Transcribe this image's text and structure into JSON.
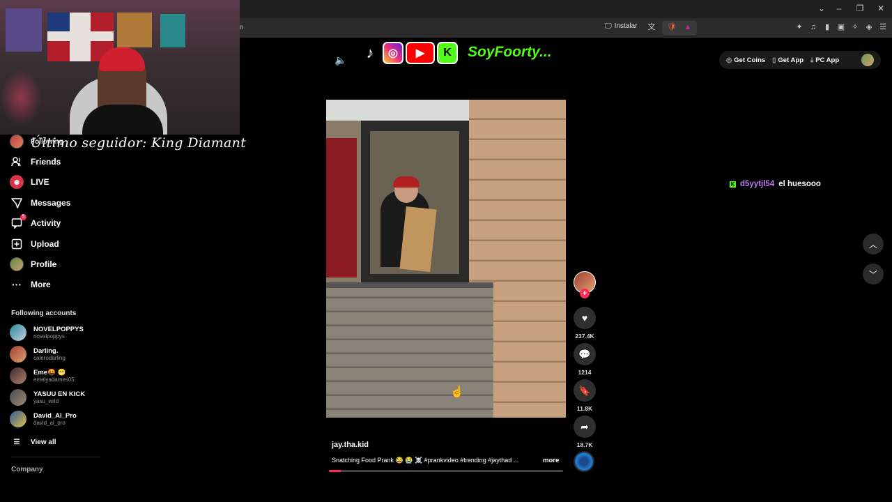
{
  "browser": {
    "url": "n",
    "install_label": "Instalar",
    "window_controls": [
      "chevron-down-icon",
      "minimize-icon",
      "restore-icon",
      "close-icon"
    ]
  },
  "overlay": {
    "stream_text": "Último seguidor: King Diamant"
  },
  "sidebar": {
    "items": [
      {
        "label": "Following",
        "icon": "following-avatar-icon"
      },
      {
        "label": "Friends",
        "icon": "friends-icon"
      },
      {
        "label": "LIVE",
        "icon": "live-icon"
      },
      {
        "label": "Messages",
        "icon": "messages-icon"
      },
      {
        "label": "Activity",
        "icon": "activity-icon",
        "badge": "5"
      },
      {
        "label": "Upload",
        "icon": "upload-icon"
      },
      {
        "label": "Profile",
        "icon": "profile-avatar-icon"
      },
      {
        "label": "More",
        "icon": "more-icon"
      }
    ],
    "following_title": "Following accounts",
    "accounts": [
      {
        "name": "NOVELPOPPYS",
        "user": "novelpoppys"
      },
      {
        "name": "Darling.",
        "user": "calerodarling"
      },
      {
        "name": "Eme🤬 😬",
        "user": "emelyadames05"
      },
      {
        "name": "YASUU EN KICK",
        "user": "yasu_wrld"
      },
      {
        "name": "David_Al_Pro",
        "user": "david_al_pro"
      }
    ],
    "view_all": "View all",
    "company": "Company"
  },
  "header": {
    "brand": "SoyFoorty...",
    "get_coins": "Get Coins",
    "get_app": "Get App",
    "pc_app": "PC App"
  },
  "video": {
    "author": "jay.tha.kid",
    "description": "Snatching Food Prank 😂 😭 ☠️ #prankvideo #trending #jaythad ...",
    "more": "more",
    "progress": 0.05,
    "likes": "237.4K",
    "comments": "1214",
    "saves": "11.8K",
    "shares": "18.7K"
  },
  "chat": {
    "user": "d5yytjl54",
    "message": "el huesooo"
  },
  "colors": {
    "accent": "#fe2c55",
    "kick_green": "#53fc18",
    "chat_user": "#b880f0"
  }
}
